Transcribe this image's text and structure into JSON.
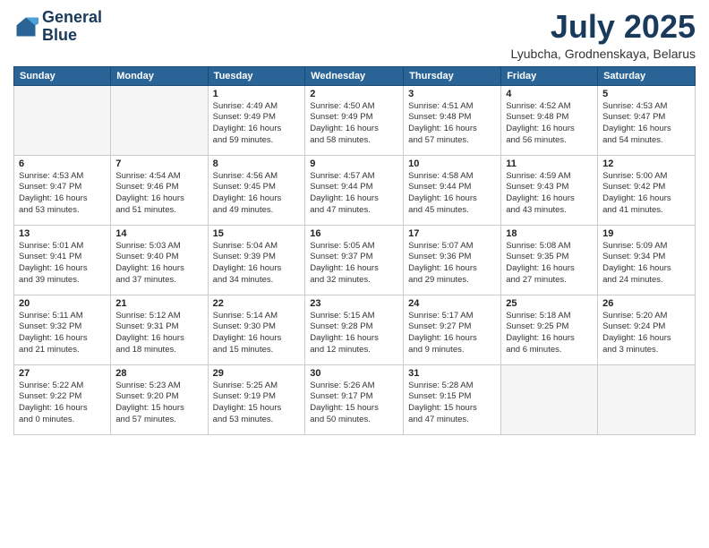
{
  "header": {
    "logo_line1": "General",
    "logo_line2": "Blue",
    "month_title": "July 2025",
    "location": "Lyubcha, Grodnenskaya, Belarus"
  },
  "weekdays": [
    "Sunday",
    "Monday",
    "Tuesday",
    "Wednesday",
    "Thursday",
    "Friday",
    "Saturday"
  ],
  "weeks": [
    [
      {
        "day": "",
        "info": ""
      },
      {
        "day": "",
        "info": ""
      },
      {
        "day": "1",
        "info": "Sunrise: 4:49 AM\nSunset: 9:49 PM\nDaylight: 16 hours\nand 59 minutes."
      },
      {
        "day": "2",
        "info": "Sunrise: 4:50 AM\nSunset: 9:49 PM\nDaylight: 16 hours\nand 58 minutes."
      },
      {
        "day": "3",
        "info": "Sunrise: 4:51 AM\nSunset: 9:48 PM\nDaylight: 16 hours\nand 57 minutes."
      },
      {
        "day": "4",
        "info": "Sunrise: 4:52 AM\nSunset: 9:48 PM\nDaylight: 16 hours\nand 56 minutes."
      },
      {
        "day": "5",
        "info": "Sunrise: 4:53 AM\nSunset: 9:47 PM\nDaylight: 16 hours\nand 54 minutes."
      }
    ],
    [
      {
        "day": "6",
        "info": "Sunrise: 4:53 AM\nSunset: 9:47 PM\nDaylight: 16 hours\nand 53 minutes."
      },
      {
        "day": "7",
        "info": "Sunrise: 4:54 AM\nSunset: 9:46 PM\nDaylight: 16 hours\nand 51 minutes."
      },
      {
        "day": "8",
        "info": "Sunrise: 4:56 AM\nSunset: 9:45 PM\nDaylight: 16 hours\nand 49 minutes."
      },
      {
        "day": "9",
        "info": "Sunrise: 4:57 AM\nSunset: 9:44 PM\nDaylight: 16 hours\nand 47 minutes."
      },
      {
        "day": "10",
        "info": "Sunrise: 4:58 AM\nSunset: 9:44 PM\nDaylight: 16 hours\nand 45 minutes."
      },
      {
        "day": "11",
        "info": "Sunrise: 4:59 AM\nSunset: 9:43 PM\nDaylight: 16 hours\nand 43 minutes."
      },
      {
        "day": "12",
        "info": "Sunrise: 5:00 AM\nSunset: 9:42 PM\nDaylight: 16 hours\nand 41 minutes."
      }
    ],
    [
      {
        "day": "13",
        "info": "Sunrise: 5:01 AM\nSunset: 9:41 PM\nDaylight: 16 hours\nand 39 minutes."
      },
      {
        "day": "14",
        "info": "Sunrise: 5:03 AM\nSunset: 9:40 PM\nDaylight: 16 hours\nand 37 minutes."
      },
      {
        "day": "15",
        "info": "Sunrise: 5:04 AM\nSunset: 9:39 PM\nDaylight: 16 hours\nand 34 minutes."
      },
      {
        "day": "16",
        "info": "Sunrise: 5:05 AM\nSunset: 9:37 PM\nDaylight: 16 hours\nand 32 minutes."
      },
      {
        "day": "17",
        "info": "Sunrise: 5:07 AM\nSunset: 9:36 PM\nDaylight: 16 hours\nand 29 minutes."
      },
      {
        "day": "18",
        "info": "Sunrise: 5:08 AM\nSunset: 9:35 PM\nDaylight: 16 hours\nand 27 minutes."
      },
      {
        "day": "19",
        "info": "Sunrise: 5:09 AM\nSunset: 9:34 PM\nDaylight: 16 hours\nand 24 minutes."
      }
    ],
    [
      {
        "day": "20",
        "info": "Sunrise: 5:11 AM\nSunset: 9:32 PM\nDaylight: 16 hours\nand 21 minutes."
      },
      {
        "day": "21",
        "info": "Sunrise: 5:12 AM\nSunset: 9:31 PM\nDaylight: 16 hours\nand 18 minutes."
      },
      {
        "day": "22",
        "info": "Sunrise: 5:14 AM\nSunset: 9:30 PM\nDaylight: 16 hours\nand 15 minutes."
      },
      {
        "day": "23",
        "info": "Sunrise: 5:15 AM\nSunset: 9:28 PM\nDaylight: 16 hours\nand 12 minutes."
      },
      {
        "day": "24",
        "info": "Sunrise: 5:17 AM\nSunset: 9:27 PM\nDaylight: 16 hours\nand 9 minutes."
      },
      {
        "day": "25",
        "info": "Sunrise: 5:18 AM\nSunset: 9:25 PM\nDaylight: 16 hours\nand 6 minutes."
      },
      {
        "day": "26",
        "info": "Sunrise: 5:20 AM\nSunset: 9:24 PM\nDaylight: 16 hours\nand 3 minutes."
      }
    ],
    [
      {
        "day": "27",
        "info": "Sunrise: 5:22 AM\nSunset: 9:22 PM\nDaylight: 16 hours\nand 0 minutes."
      },
      {
        "day": "28",
        "info": "Sunrise: 5:23 AM\nSunset: 9:20 PM\nDaylight: 15 hours\nand 57 minutes."
      },
      {
        "day": "29",
        "info": "Sunrise: 5:25 AM\nSunset: 9:19 PM\nDaylight: 15 hours\nand 53 minutes."
      },
      {
        "day": "30",
        "info": "Sunrise: 5:26 AM\nSunset: 9:17 PM\nDaylight: 15 hours\nand 50 minutes."
      },
      {
        "day": "31",
        "info": "Sunrise: 5:28 AM\nSunset: 9:15 PM\nDaylight: 15 hours\nand 47 minutes."
      },
      {
        "day": "",
        "info": ""
      },
      {
        "day": "",
        "info": ""
      }
    ]
  ]
}
